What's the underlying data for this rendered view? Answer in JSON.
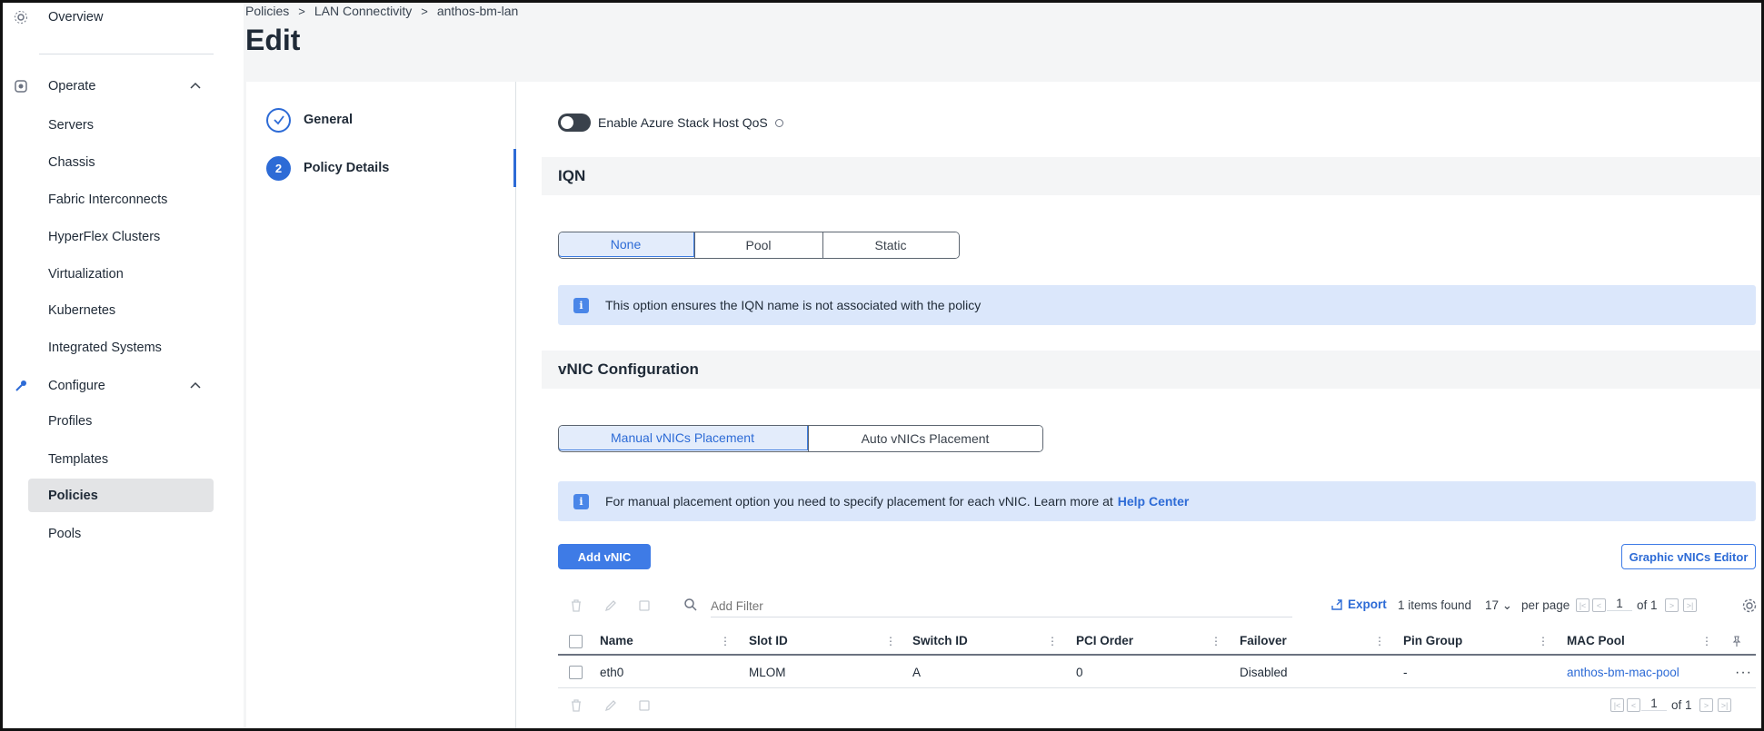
{
  "breadcrumb": {
    "items": [
      "Policies",
      "LAN Connectivity",
      "anthos-bm-lan"
    ],
    "separator": ">"
  },
  "page_title": "Edit",
  "sidebar": {
    "overview": "Overview",
    "operate": {
      "label": "Operate",
      "items": [
        "Servers",
        "Chassis",
        "Fabric Interconnects",
        "HyperFlex Clusters",
        "Virtualization",
        "Kubernetes",
        "Integrated Systems"
      ]
    },
    "configure": {
      "label": "Configure",
      "items": [
        "Profiles",
        "Templates",
        "Policies",
        "Pools"
      ],
      "active": "Policies"
    }
  },
  "wizard": {
    "steps": [
      {
        "label": "General",
        "state": "complete"
      },
      {
        "label": "Policy Details",
        "number": "2",
        "state": "current"
      }
    ]
  },
  "content": {
    "toggle_label": "Enable Azure Stack Host QoS",
    "toggle_on": false,
    "iqn": {
      "title": "IQN",
      "options": [
        "None",
        "Pool",
        "Static"
      ],
      "selected": "None",
      "info": "This option ensures the IQN name is not associated with the policy"
    },
    "vnic": {
      "title": "vNIC Configuration",
      "options": [
        "Manual vNICs Placement",
        "Auto vNICs Placement"
      ],
      "selected": "Manual vNICs Placement",
      "info_text": "For manual placement option you need to specify placement for each vNIC. Learn more at",
      "info_link": "Help Center",
      "add_button": "Add vNIC",
      "graphic_button": "Graphic vNICs Editor"
    }
  },
  "table": {
    "filter_placeholder": "Add Filter",
    "export_label": "Export",
    "items_found": "1 items found",
    "per_page_value": "17",
    "per_page_label": "per page",
    "page": "1",
    "of_pages": "of 1",
    "columns": [
      "Name",
      "Slot ID",
      "Switch ID",
      "PCI Order",
      "Failover",
      "Pin Group",
      "MAC Pool"
    ],
    "rows": [
      [
        "eth0",
        "MLOM",
        "A",
        "0",
        "Disabled",
        "-",
        "anthos-bm-mac-pool"
      ]
    ]
  },
  "colors": {
    "accent": "#2d6bd6",
    "primary_button": "#3e7be6",
    "info_banner": "#dbe7fb",
    "active_nav": "#e3e4e6"
  }
}
